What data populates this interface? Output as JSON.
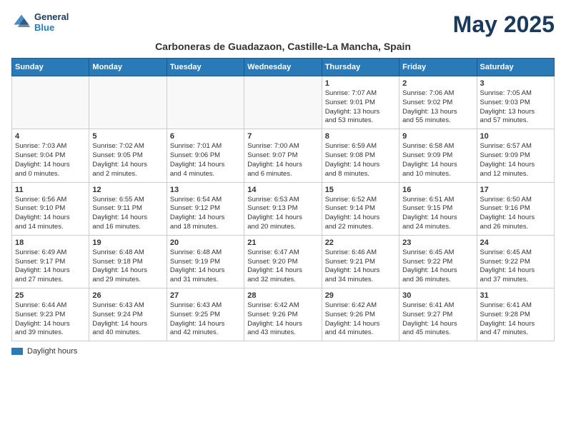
{
  "header": {
    "logo_line1": "General",
    "logo_line2": "Blue",
    "title": "May 2025",
    "subtitle": "Carboneras de Guadazaon, Castille-La Mancha, Spain"
  },
  "days_of_week": [
    "Sunday",
    "Monday",
    "Tuesday",
    "Wednesday",
    "Thursday",
    "Friday",
    "Saturday"
  ],
  "weeks": [
    [
      {
        "day": "",
        "info": ""
      },
      {
        "day": "",
        "info": ""
      },
      {
        "day": "",
        "info": ""
      },
      {
        "day": "",
        "info": ""
      },
      {
        "day": "1",
        "info": "Sunrise: 7:07 AM\nSunset: 9:01 PM\nDaylight: 13 hours\nand 53 minutes."
      },
      {
        "day": "2",
        "info": "Sunrise: 7:06 AM\nSunset: 9:02 PM\nDaylight: 13 hours\nand 55 minutes."
      },
      {
        "day": "3",
        "info": "Sunrise: 7:05 AM\nSunset: 9:03 PM\nDaylight: 13 hours\nand 57 minutes."
      }
    ],
    [
      {
        "day": "4",
        "info": "Sunrise: 7:03 AM\nSunset: 9:04 PM\nDaylight: 14 hours\nand 0 minutes."
      },
      {
        "day": "5",
        "info": "Sunrise: 7:02 AM\nSunset: 9:05 PM\nDaylight: 14 hours\nand 2 minutes."
      },
      {
        "day": "6",
        "info": "Sunrise: 7:01 AM\nSunset: 9:06 PM\nDaylight: 14 hours\nand 4 minutes."
      },
      {
        "day": "7",
        "info": "Sunrise: 7:00 AM\nSunset: 9:07 PM\nDaylight: 14 hours\nand 6 minutes."
      },
      {
        "day": "8",
        "info": "Sunrise: 6:59 AM\nSunset: 9:08 PM\nDaylight: 14 hours\nand 8 minutes."
      },
      {
        "day": "9",
        "info": "Sunrise: 6:58 AM\nSunset: 9:09 PM\nDaylight: 14 hours\nand 10 minutes."
      },
      {
        "day": "10",
        "info": "Sunrise: 6:57 AM\nSunset: 9:09 PM\nDaylight: 14 hours\nand 12 minutes."
      }
    ],
    [
      {
        "day": "11",
        "info": "Sunrise: 6:56 AM\nSunset: 9:10 PM\nDaylight: 14 hours\nand 14 minutes."
      },
      {
        "day": "12",
        "info": "Sunrise: 6:55 AM\nSunset: 9:11 PM\nDaylight: 14 hours\nand 16 minutes."
      },
      {
        "day": "13",
        "info": "Sunrise: 6:54 AM\nSunset: 9:12 PM\nDaylight: 14 hours\nand 18 minutes."
      },
      {
        "day": "14",
        "info": "Sunrise: 6:53 AM\nSunset: 9:13 PM\nDaylight: 14 hours\nand 20 minutes."
      },
      {
        "day": "15",
        "info": "Sunrise: 6:52 AM\nSunset: 9:14 PM\nDaylight: 14 hours\nand 22 minutes."
      },
      {
        "day": "16",
        "info": "Sunrise: 6:51 AM\nSunset: 9:15 PM\nDaylight: 14 hours\nand 24 minutes."
      },
      {
        "day": "17",
        "info": "Sunrise: 6:50 AM\nSunset: 9:16 PM\nDaylight: 14 hours\nand 26 minutes."
      }
    ],
    [
      {
        "day": "18",
        "info": "Sunrise: 6:49 AM\nSunset: 9:17 PM\nDaylight: 14 hours\nand 27 minutes."
      },
      {
        "day": "19",
        "info": "Sunrise: 6:48 AM\nSunset: 9:18 PM\nDaylight: 14 hours\nand 29 minutes."
      },
      {
        "day": "20",
        "info": "Sunrise: 6:48 AM\nSunset: 9:19 PM\nDaylight: 14 hours\nand 31 minutes."
      },
      {
        "day": "21",
        "info": "Sunrise: 6:47 AM\nSunset: 9:20 PM\nDaylight: 14 hours\nand 32 minutes."
      },
      {
        "day": "22",
        "info": "Sunrise: 6:46 AM\nSunset: 9:21 PM\nDaylight: 14 hours\nand 34 minutes."
      },
      {
        "day": "23",
        "info": "Sunrise: 6:45 AM\nSunset: 9:22 PM\nDaylight: 14 hours\nand 36 minutes."
      },
      {
        "day": "24",
        "info": "Sunrise: 6:45 AM\nSunset: 9:22 PM\nDaylight: 14 hours\nand 37 minutes."
      }
    ],
    [
      {
        "day": "25",
        "info": "Sunrise: 6:44 AM\nSunset: 9:23 PM\nDaylight: 14 hours\nand 39 minutes."
      },
      {
        "day": "26",
        "info": "Sunrise: 6:43 AM\nSunset: 9:24 PM\nDaylight: 14 hours\nand 40 minutes."
      },
      {
        "day": "27",
        "info": "Sunrise: 6:43 AM\nSunset: 9:25 PM\nDaylight: 14 hours\nand 42 minutes."
      },
      {
        "day": "28",
        "info": "Sunrise: 6:42 AM\nSunset: 9:26 PM\nDaylight: 14 hours\nand 43 minutes."
      },
      {
        "day": "29",
        "info": "Sunrise: 6:42 AM\nSunset: 9:26 PM\nDaylight: 14 hours\nand 44 minutes."
      },
      {
        "day": "30",
        "info": "Sunrise: 6:41 AM\nSunset: 9:27 PM\nDaylight: 14 hours\nand 45 minutes."
      },
      {
        "day": "31",
        "info": "Sunrise: 6:41 AM\nSunset: 9:28 PM\nDaylight: 14 hours\nand 47 minutes."
      }
    ]
  ],
  "legend": {
    "label": "Daylight hours"
  }
}
